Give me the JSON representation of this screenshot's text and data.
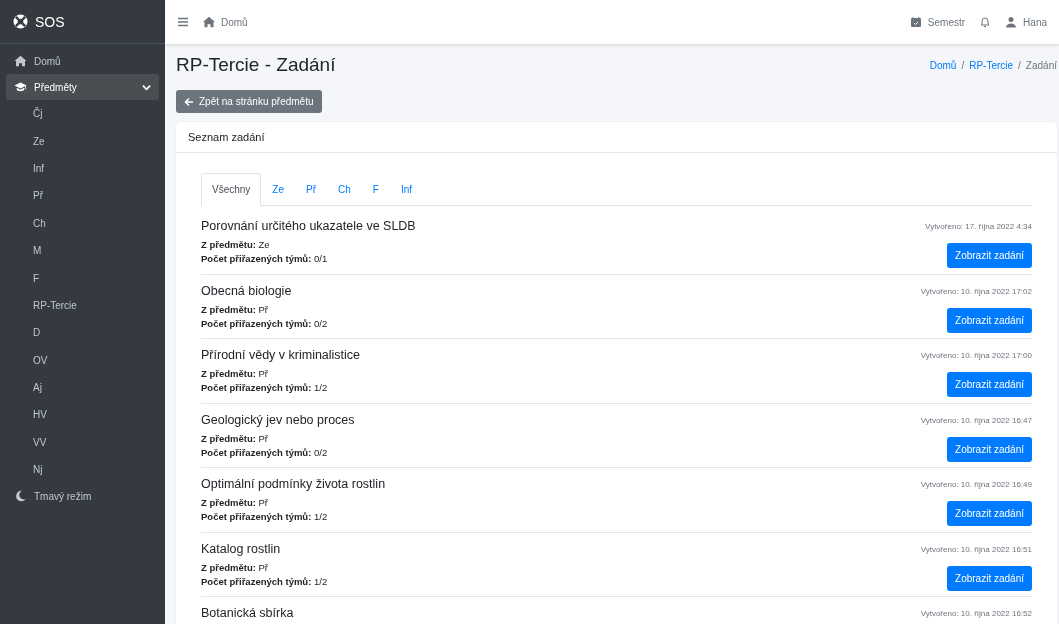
{
  "brand": {
    "title": "SOS"
  },
  "sidebar": {
    "items": [
      {
        "kind": "home",
        "label": "Domů",
        "selected": false
      },
      {
        "kind": "group",
        "label": "Předměty",
        "selected": true,
        "expanded": true,
        "children": [
          {
            "label": "Čj"
          },
          {
            "label": "Ze"
          },
          {
            "label": "Inf"
          },
          {
            "label": "Př"
          },
          {
            "label": "Ch"
          },
          {
            "label": "M"
          },
          {
            "label": "F"
          },
          {
            "label": "RP-Tercie"
          },
          {
            "label": "D"
          },
          {
            "label": "OV"
          },
          {
            "label": "Aj"
          },
          {
            "label": "HV"
          },
          {
            "label": "VV"
          },
          {
            "label": "Nj"
          }
        ]
      },
      {
        "kind": "theme",
        "label": "Tmavý režim",
        "selected": false
      }
    ]
  },
  "topbar": {
    "home_link": "Domů",
    "semester": "Semestr",
    "user": "Hana"
  },
  "page": {
    "title": "RP-Tercie - Zadání",
    "breadcrumb_separator": "/",
    "breadcrumb": [
      {
        "label": "Domů",
        "link": true
      },
      {
        "label": "RP-Tercie",
        "link": true
      },
      {
        "label": "Zadání",
        "link": false
      }
    ],
    "back_button": "Zpět na stránku předmětu"
  },
  "card": {
    "title": "Seznam zadání",
    "tabs": [
      {
        "label": "Všechny",
        "selected": true
      },
      {
        "label": "Ze",
        "selected": false
      },
      {
        "label": "Př",
        "selected": false
      },
      {
        "label": "Ch",
        "selected": false
      },
      {
        "label": "F",
        "selected": false
      },
      {
        "label": "Inf",
        "selected": false
      }
    ],
    "assignments": [
      {
        "title": "Porovnání určitého ukazatele ve SLDB",
        "subject": "**Z předmětu:** Ze",
        "teams": "**Počet přiřazených týmů:** 0/1",
        "created": "Vytvořeno: 17. října 2022 4:34",
        "button": "Zobrazit zadání"
      },
      {
        "title": "Obecná biologie",
        "subject": "**Z předmětu:** Př",
        "teams": "**Počet přiřazených týmů:** 0/2",
        "created": "Vytvořeno: 10. října 2022 17:02",
        "button": "Zobrazit zadání"
      },
      {
        "title": "Přírodní vědy v kriminalistice",
        "subject": "**Z předmětu:** Př",
        "teams": "**Počet přiřazených týmů:** 1/2",
        "created": "Vytvořeno: 10. října 2022 17:00",
        "button": "Zobrazit zadání"
      },
      {
        "title": "Geologický jev nebo proces",
        "subject": "**Z předmětu:** Př",
        "teams": "**Počet přiřazených týmů:** 0/2",
        "created": "Vytvořeno: 10. října 2022 16:47",
        "button": "Zobrazit zadání"
      },
      {
        "title": "Optimální podmínky života rostlin",
        "subject": "**Z předmětu:** Př",
        "teams": "**Počet přiřazených týmů:** 1/2",
        "created": "Vytvořeno: 10. října 2022 16:49",
        "button": "Zobrazit zadání"
      },
      {
        "title": "Katalog rostlin",
        "subject": "**Z předmětu:** Př",
        "teams": "**Počet přiřazených týmů:** 1/2",
        "created": "Vytvořeno: 10. října 2022 16:51",
        "button": "Zobrazit zadání"
      },
      {
        "title": "Botanická sbírka",
        "created": "Vytvořeno: 10. října 2022 16:52"
      }
    ]
  }
}
